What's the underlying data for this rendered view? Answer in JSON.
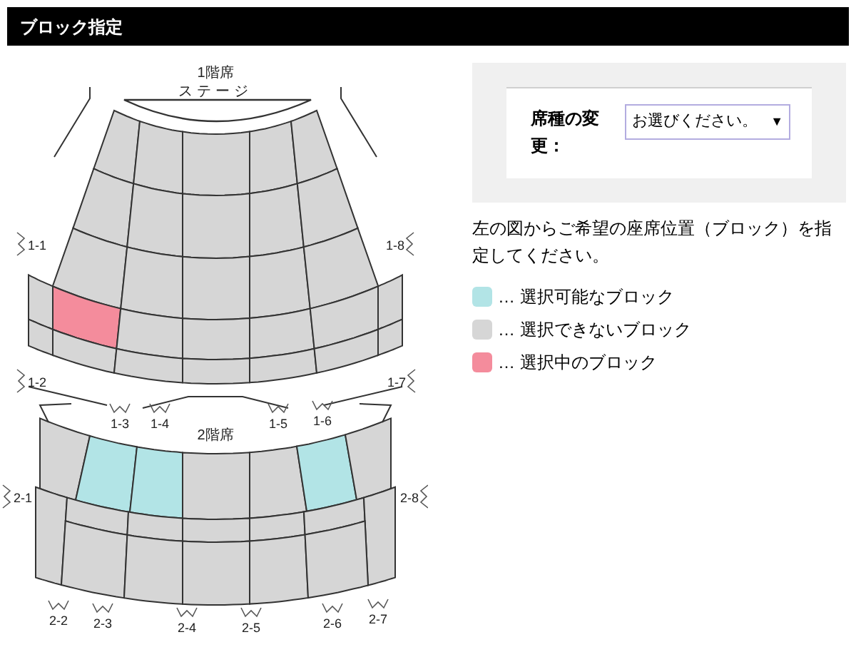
{
  "header": {
    "title": "ブロック指定"
  },
  "seat_map": {
    "floors": [
      {
        "label": "1階席",
        "stage_label": "ステージ",
        "rows": [
          [
            {
              "available": false,
              "selected": false
            },
            {
              "available": false,
              "selected": false
            },
            {
              "available": false,
              "selected": false
            },
            {
              "available": false,
              "selected": false
            },
            {
              "available": false,
              "selected": false
            }
          ],
          [
            {
              "available": false,
              "selected": false
            },
            {
              "available": false,
              "selected": false
            },
            {
              "available": false,
              "selected": false
            },
            {
              "available": false,
              "selected": false
            },
            {
              "available": false,
              "selected": false
            }
          ],
          [
            {
              "available": false,
              "selected": false
            },
            {
              "available": false,
              "selected": false
            },
            {
              "available": false,
              "selected": false
            },
            {
              "available": false,
              "selected": false
            },
            {
              "available": false,
              "selected": false
            }
          ],
          [
            {
              "available": false,
              "selected": false
            },
            {
              "available": true,
              "selected": true
            },
            {
              "available": false,
              "selected": false
            },
            {
              "available": false,
              "selected": false
            },
            {
              "available": false,
              "selected": false
            },
            {
              "available": false,
              "selected": false
            },
            {
              "available": false,
              "selected": false
            }
          ],
          [
            {
              "available": false,
              "selected": false
            },
            {
              "available": false,
              "selected": false
            },
            {
              "available": false,
              "selected": false
            },
            {
              "available": false,
              "selected": false
            },
            {
              "available": false,
              "selected": false
            },
            {
              "available": false,
              "selected": false
            },
            {
              "available": false,
              "selected": false
            }
          ]
        ],
        "doors": [
          "1-1",
          "1-8",
          "1-2",
          "1-7",
          "1-3",
          "1-4",
          "1-5",
          "1-6"
        ]
      },
      {
        "label": "2階席",
        "rows": [
          [
            {
              "available": false,
              "selected": false
            },
            {
              "available": true,
              "selected": false
            },
            {
              "available": true,
              "selected": false
            },
            {
              "available": false,
              "selected": false
            },
            {
              "available": false,
              "selected": false
            },
            {
              "available": true,
              "selected": false
            },
            {
              "available": false,
              "selected": false
            }
          ],
          [
            {
              "available": false,
              "selected": false
            },
            {
              "available": false,
              "selected": false
            },
            {
              "available": false,
              "selected": false
            },
            {
              "available": false,
              "selected": false
            },
            {
              "available": false,
              "selected": false
            },
            {
              "available": false,
              "selected": false
            },
            {
              "available": false,
              "selected": false
            }
          ],
          [
            {
              "available": false,
              "selected": false
            },
            {
              "available": false,
              "selected": false
            },
            {
              "available": false,
              "selected": false
            },
            {
              "available": false,
              "selected": false
            },
            {
              "available": false,
              "selected": false
            }
          ]
        ],
        "doors": [
          "2-1",
          "2-8",
          "2-2",
          "2-3",
          "2-4",
          "2-5",
          "2-6",
          "2-7"
        ]
      }
    ]
  },
  "seat_type": {
    "label": "席種の変更：",
    "select": {
      "value": "お選びください。",
      "arrow": "▼"
    }
  },
  "instruction": "左の図からご希望の座席位置（ブロック）を指定してください。",
  "legend": [
    {
      "kind": "available",
      "color": "#b2e4e6",
      "label": "… 選択可能なブロック"
    },
    {
      "kind": "unavailable",
      "color": "#d6d6d6",
      "label": "… 選択できないブロック"
    },
    {
      "kind": "selected",
      "color": "#f48c9c",
      "label": "… 選択中のブロック"
    }
  ]
}
